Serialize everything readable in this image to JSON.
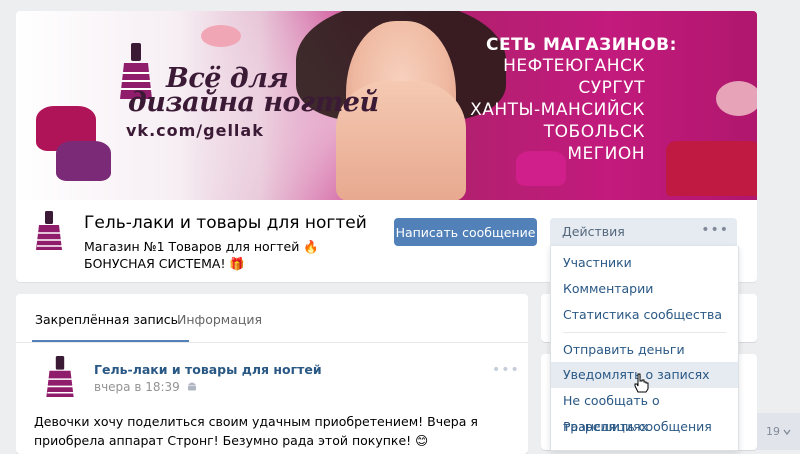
{
  "cover": {
    "brand_line1": "Всё для",
    "brand_line2": "дизайна ногтей",
    "site": "vk.com/gellak",
    "network_title": "СЕТЬ МАГАЗИНОВ:",
    "cities": [
      "НЕФТЕЮГАНСК",
      "СУРГУТ",
      "ХАНТЫ-МАНСИЙСК",
      "ТОБОЛЬСК",
      "МЕГИОН"
    ]
  },
  "header": {
    "name": "Гель-лаки и товары для ногтей",
    "status": "Магазин №1 Товаров для ногтей 🔥 БОНУСНАЯ СИСТЕМА! 🎁",
    "message_button": "Написать сообщение",
    "actions_button": "Действия",
    "actions_dots": "•••"
  },
  "actions_menu": {
    "items": [
      "Участники",
      "Комментарии",
      "Статистика сообщества",
      "Отправить деньги",
      "Уведомлять о записях",
      "Не сообщать о трансляциях",
      "Разрешить сообщения"
    ],
    "highlighted": "Уведомлять о записях"
  },
  "tabs": {
    "pinned": "Закреплённая запись",
    "info": "Информация"
  },
  "post": {
    "author": "Гель-лаки и товары для ногтей",
    "time": "вчера в 18:39",
    "menu": "•••",
    "text": "Девочки хочу поделиться своим удачным приобретением! Вчера я приобрела аппарат Стронг! Безумно рада этой покупке! 😊"
  },
  "page_counter": {
    "value": "19"
  },
  "colors": {
    "accent": "#5181b8",
    "link": "#2a5885",
    "background": "#edeef0",
    "cover_magenta": "#c21a7d"
  }
}
